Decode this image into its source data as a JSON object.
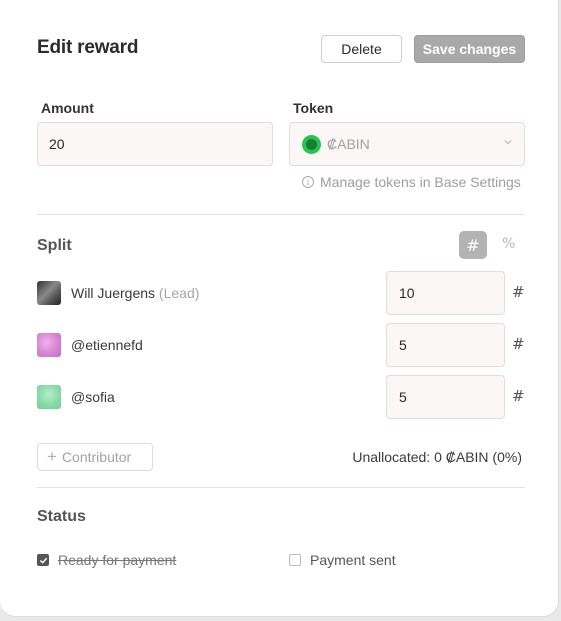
{
  "modal": {
    "title": "Edit reward",
    "delete_label": "Delete",
    "save_label": "Save changes"
  },
  "amount": {
    "label": "Amount",
    "value": "20"
  },
  "token": {
    "label": "Token",
    "value": "₡ABIN",
    "manage_link": "Manage tokens in Base Settings"
  },
  "split": {
    "title": "Split",
    "mode_hash": "#",
    "mode_percent": "%",
    "members": [
      {
        "name": "Will Juergens",
        "role": "(Lead)",
        "share": "10",
        "unit": "#"
      },
      {
        "name": "@etiennefd",
        "role": "",
        "share": "5",
        "unit": "#"
      },
      {
        "name": "@sofia",
        "role": "",
        "share": "5",
        "unit": "#"
      }
    ],
    "add_contributor": "Contributor",
    "unallocated": "Unallocated: 0 ₡ABIN (0%)"
  },
  "status": {
    "title": "Status",
    "ready_label": "Ready for payment",
    "ready_checked": true,
    "sent_label": "Payment sent",
    "sent_checked": false
  },
  "colors": {
    "save_button": "#a9a9a9",
    "token_coin": "#27c452",
    "input_bg": "#fcf7f7"
  }
}
